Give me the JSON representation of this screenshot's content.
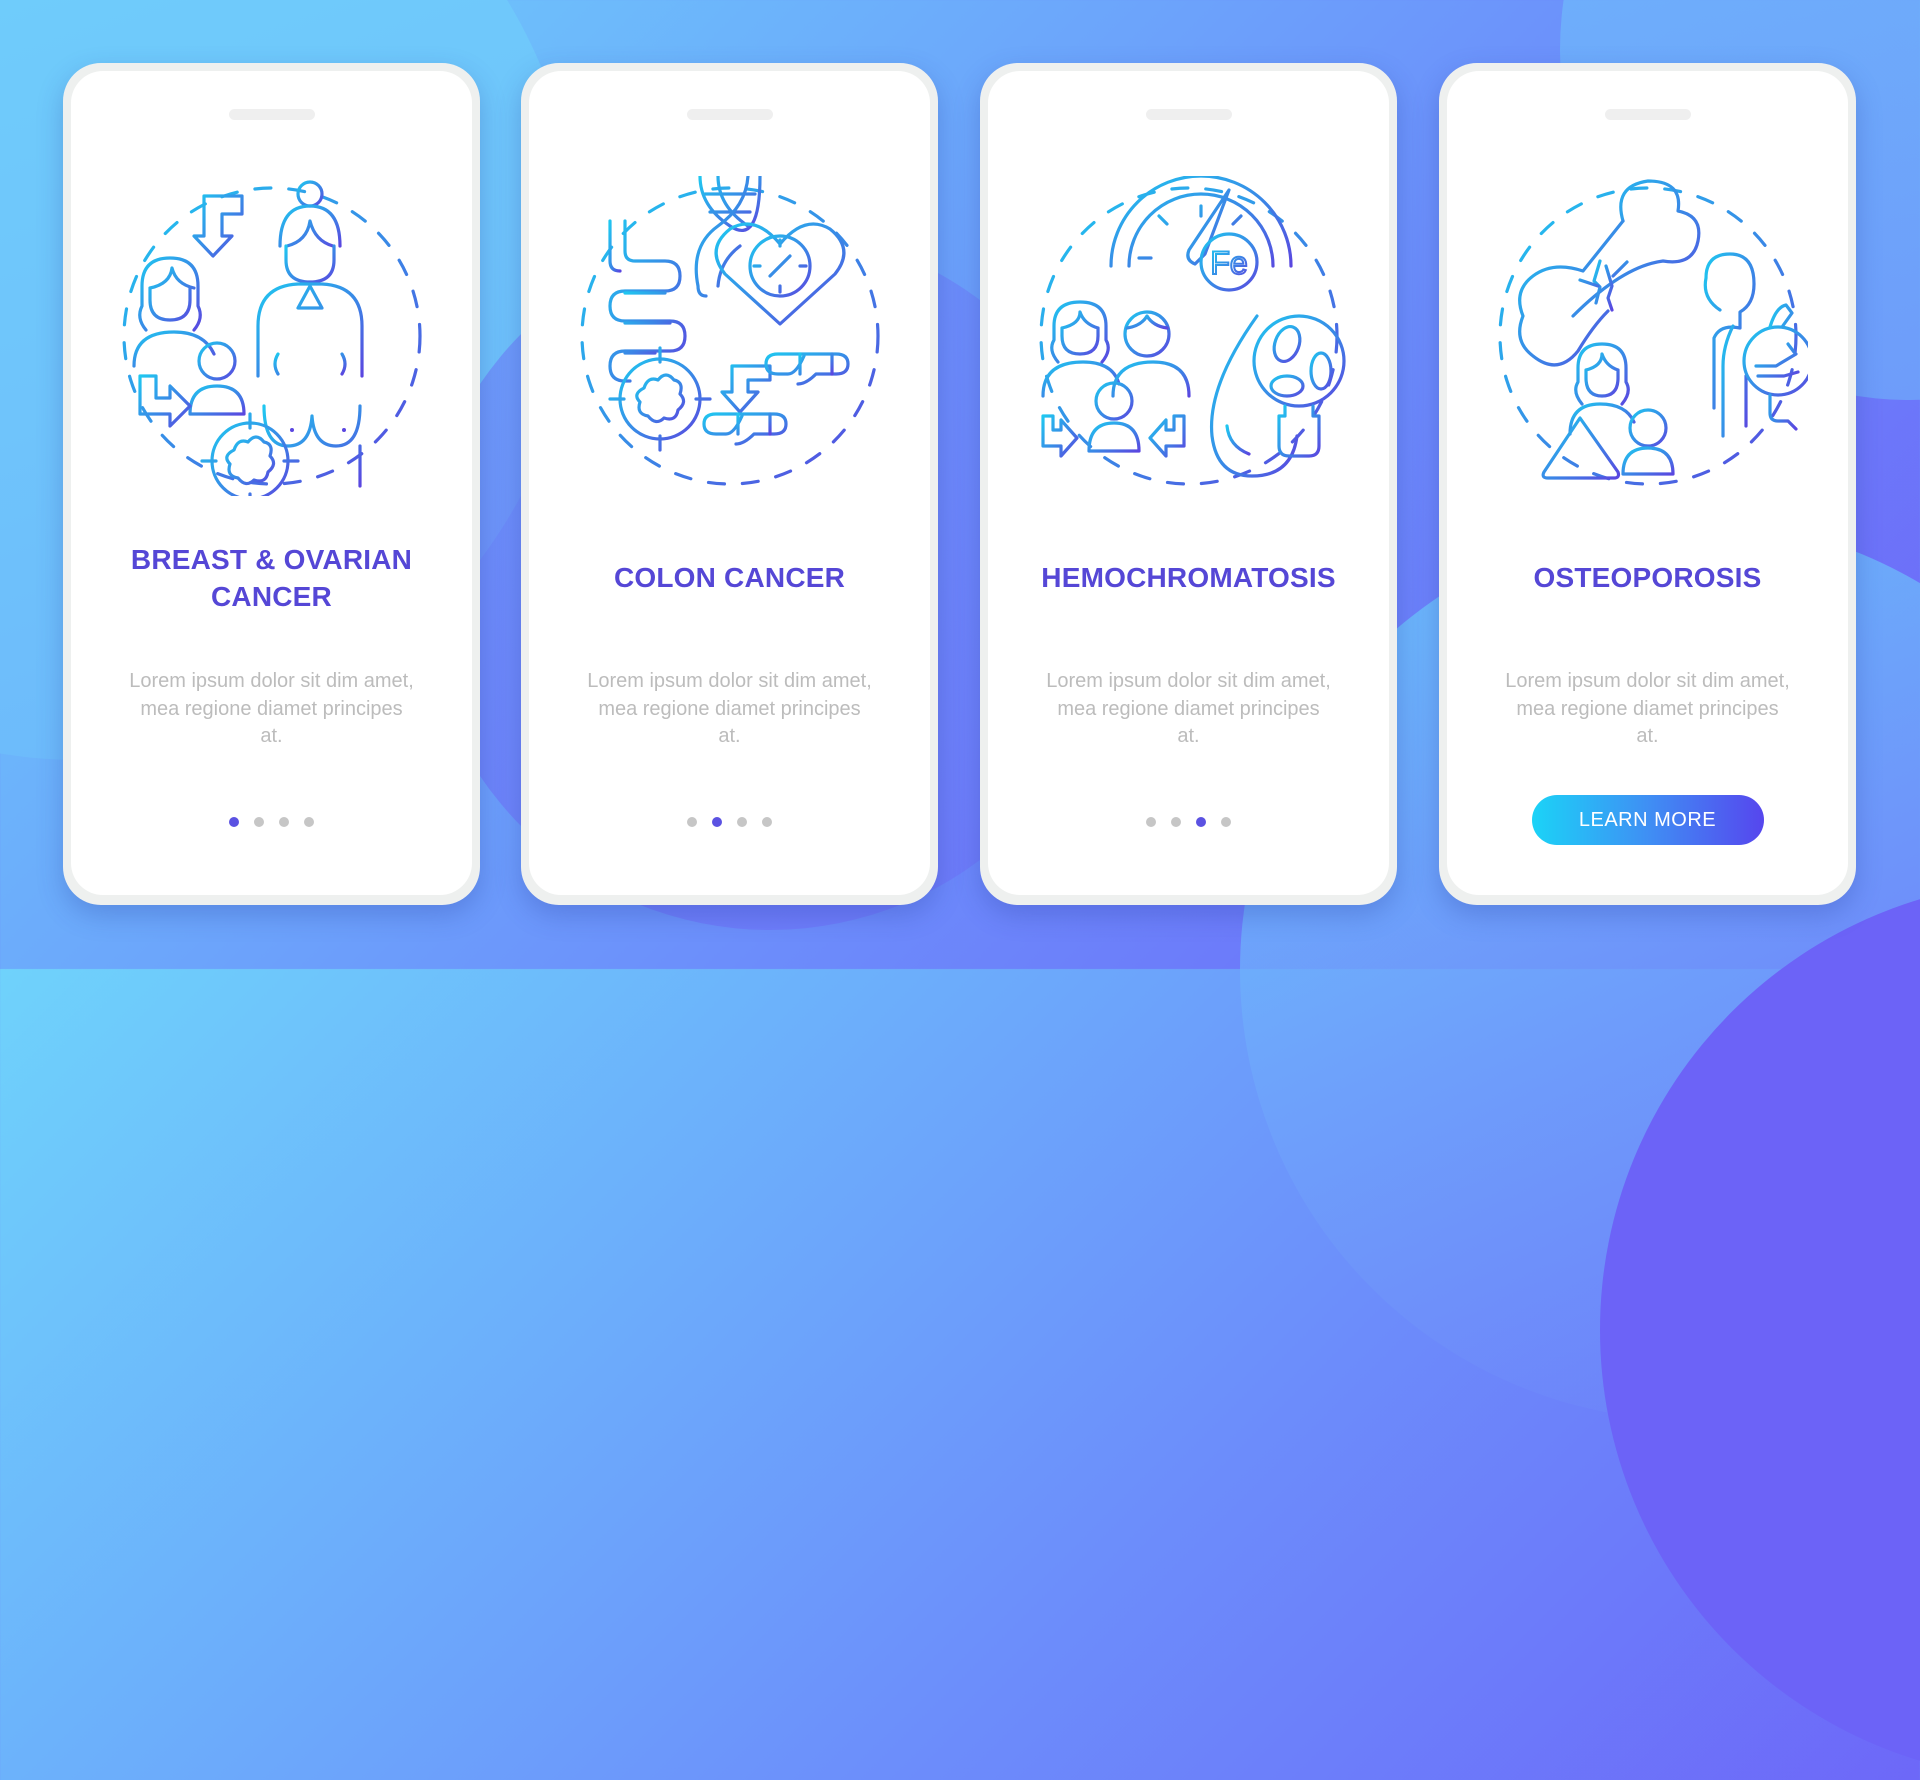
{
  "theme": {
    "accent_title": "#5547d6",
    "body_text": "#bcbcbc",
    "dot_active": "#5b52e2",
    "dot_inactive": "#c6c6c6",
    "icon_gradient_start": "#1fc7f0",
    "icon_gradient_end": "#5a46e0",
    "button_gradient": [
      "#1bd3f7",
      "#5646ee"
    ]
  },
  "screens": [
    {
      "illustration": "family-history-breast-cancer-illustration",
      "title_lines": [
        "BREAST & OVARIAN",
        "CANCER"
      ],
      "body": "Lorem ipsum dolor sit dim amet, mea regione diamet principes at.",
      "pager": {
        "total": 4,
        "active": 1
      }
    },
    {
      "illustration": "colon-cancer-dna-illustration",
      "title_lines": [
        "COLON CANCER"
      ],
      "body": "Lorem ipsum dolor sit dim amet, mea regione diamet principes at.",
      "pager": {
        "total": 4,
        "active": 2
      }
    },
    {
      "illustration": "iron-overload-liver-illustration",
      "title_lines": [
        "HEMOCHROMATOSIS"
      ],
      "body": "Lorem ipsum dolor sit dim amet, mea regione diamet principes at.",
      "pager": {
        "total": 4,
        "active": 3
      }
    },
    {
      "illustration": "broken-bone-spine-illustration",
      "title_lines": [
        "OSTEOPOROSIS"
      ],
      "body": "Lorem ipsum dolor sit dim amet, mea regione diamet principes at.",
      "button": {
        "label": "LEARN MORE"
      }
    }
  ]
}
